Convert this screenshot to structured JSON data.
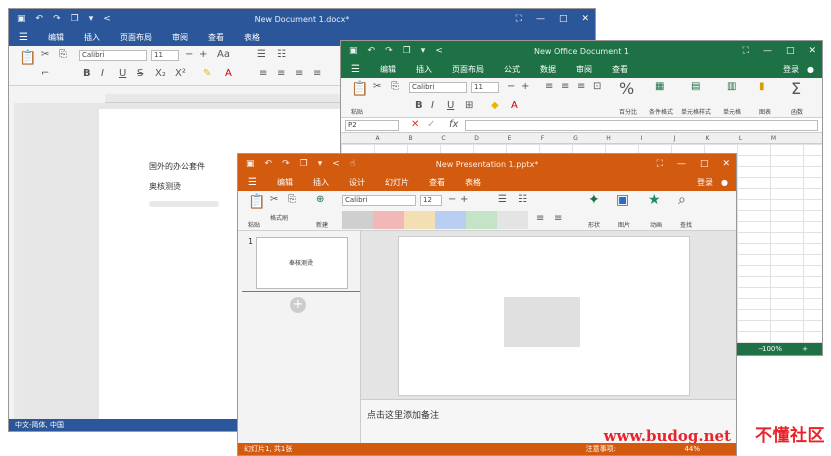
{
  "writer": {
    "title": "New Document 1.docx*",
    "menu": [
      "编辑",
      "插入",
      "页面布局",
      "审阅",
      "查看",
      "表格"
    ],
    "font_name": "Calibri",
    "font_size": "11",
    "doc_lines": [
      "国外的办公套件",
      "奥核测烫"
    ],
    "status_text": "中文-简体, 中国",
    "colors": {
      "accent": "#2b579a"
    }
  },
  "calc": {
    "title": "New Office Document 1",
    "menu": [
      "编辑",
      "插入",
      "页面布局",
      "公式",
      "数据",
      "审阅",
      "查看"
    ],
    "login": "登录",
    "font_name": "Calibri",
    "font_size": "11",
    "cell_ref": "P2",
    "fx": "fx",
    "tools": [
      "粘贴",
      "百分比",
      "条件格式",
      "单元格样式",
      "单元格",
      "图表",
      "函数"
    ],
    "col_headers": [
      "A",
      "B",
      "C",
      "D",
      "E",
      "F",
      "G",
      "H",
      "I",
      "J",
      "K",
      "L",
      "M"
    ],
    "zoom": "100%",
    "colors": {
      "accent": "#1e7145"
    }
  },
  "pres": {
    "title": "New Presentation 1.pptx*",
    "menu": [
      "编辑",
      "插入",
      "设计",
      "幻灯片",
      "查看",
      "表格"
    ],
    "login": "登录",
    "font_name": "Calibri",
    "font_size": "12",
    "tools": [
      "粘贴",
      "格式刷",
      "新建",
      "形状",
      "图片",
      "动画",
      "查找"
    ],
    "slide_number": "1",
    "thumb_text": "奉核测烫",
    "notes": "点击这里添加备注",
    "status_left": "幻灯片1, 共1张",
    "status_right": "注意事项:",
    "zoom": "44%",
    "colors": {
      "accent": "#d35b0f"
    }
  },
  "watermark": {
    "url": "www.budog.net",
    "name": "不懂社区"
  }
}
